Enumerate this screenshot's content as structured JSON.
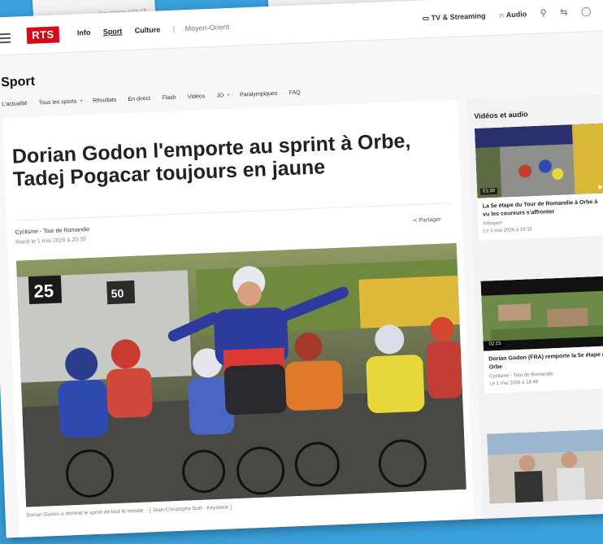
{
  "header": {
    "logo": "RTS",
    "nav": [
      "Info",
      "Sport",
      "Culture"
    ],
    "nav_extra": "Moyen-Orient",
    "right_links": [
      "TV & Streaming",
      "Audio"
    ]
  },
  "top_paper_credit": "Keystone-sda.ch",
  "section": {
    "title": "Sport",
    "subnav": [
      "L'actualité",
      "Tous les sports",
      "Résultats",
      "En direct",
      "Flash",
      "Vidéos",
      "JO",
      "Paralympiques",
      "FAQ"
    ]
  },
  "article": {
    "headline": "Dorian Godon l'emporte au sprint à Orbe, Tadej Pogacar toujours en jaune",
    "category": "Cyclisme - Tour de Romandie",
    "date": "Mardi le 1 mai 2026 à 20:35",
    "share": "Partager",
    "caption": "Dorian Godon a dominé le sprint de tout le monde. - [ Jean-Christophe Bott - Keystone ]"
  },
  "sidebar": {
    "title": "Vidéos et audio",
    "cards": [
      {
        "duration": "01:30",
        "title": "La 5e étape du Tour de Romandie à Orbe à vu les coureurs s'affronter",
        "meta1": "Infosport",
        "meta2": "Le 1 mai 2026 à 19:32"
      },
      {
        "duration": "02:15",
        "title": "Dorian Godon (FRA) remporte la 5e étape à Orbe",
        "meta1": "Cyclisme - Tour de Romandie",
        "meta2": "Le 1 mai 2026 à 18:48"
      }
    ]
  },
  "colors": {
    "brand": "#d40a1d",
    "background": "#3aa1dd"
  }
}
